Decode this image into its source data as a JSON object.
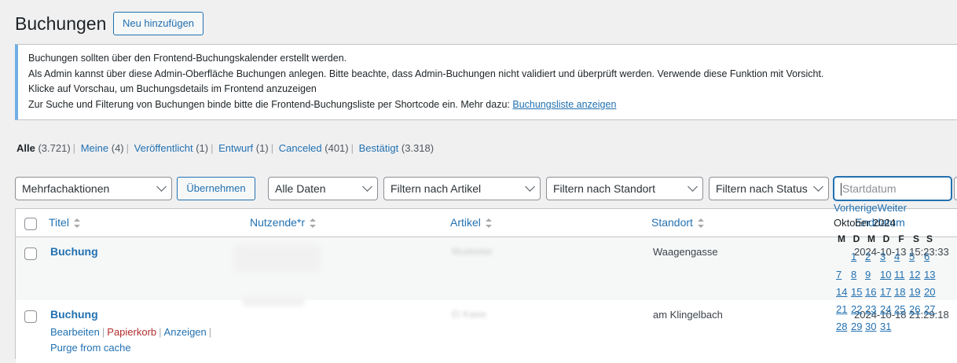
{
  "header": {
    "title": "Buchungen",
    "add_new": "Neu hinzufügen"
  },
  "notice": {
    "line1": "Buchungen sollten über den Frontend-Buchungskalender erstellt werden.",
    "line2": "Als Admin kannst über diese Admin-Oberfläche Buchungen anlegen. Bitte beachte, dass Admin-Buchungen nicht validiert und überprüft werden. Verwende diese Funktion mit Vorsicht.",
    "line3": "Klicke auf Vorschau, um Buchungsdetails im Frontend anzuzeigen",
    "line4_prefix": "Zur Suche und Filterung von Buchungen binde bitte die Frontend-Buchungsliste per Shortcode ein. Mehr dazu: ",
    "line4_link": "Buchungsliste anzeigen"
  },
  "views": [
    {
      "label": "Alle",
      "count": "(3.721)"
    },
    {
      "label": "Meine",
      "count": "(4)"
    },
    {
      "label": "Veröffentlicht",
      "count": "(1)"
    },
    {
      "label": "Entwurf",
      "count": "(1)"
    },
    {
      "label": "Canceled",
      "count": "(401)"
    },
    {
      "label": "Bestätigt",
      "count": "(3.318)"
    }
  ],
  "filters": {
    "bulk": "Mehrfachaktionen",
    "apply": "Übernehmen",
    "dates": "Alle Daten",
    "item": "Filtern nach Artikel",
    "location": "Filtern nach Standort",
    "status": "Filtern nach Status",
    "start_placeholder": "Startdatum"
  },
  "columns": {
    "title": "Titel",
    "user": "Nutzende*r",
    "item": "Artikel",
    "location": "Standort",
    "end": "Enddatum"
  },
  "rows": [
    {
      "title": "Buchung",
      "item": "Musketier",
      "location": "Waagengasse",
      "date": "2024-10-13 15:23:33"
    },
    {
      "title": "Buchung",
      "item": "El Kawe",
      "location": "am Klingelbach",
      "date": "2024-10-18 21:29:18"
    }
  ],
  "row_actions": {
    "edit": "Bearbeiten",
    "trash": "Papierkorb",
    "view": "Anzeigen",
    "purge": "Purge from cache"
  },
  "datepicker": {
    "prev": "Vorherige",
    "next": "Weiter",
    "month": "Oktober 2024",
    "weekdays": [
      "M",
      "D",
      "M",
      "D",
      "F",
      "S",
      "S"
    ],
    "weeks": [
      [
        "",
        "1",
        "2",
        "3",
        "4",
        "5",
        "6"
      ],
      [
        "7",
        "8",
        "9",
        "10",
        "11",
        "12",
        "13"
      ],
      [
        "14",
        "15",
        "16",
        "17",
        "18",
        "19",
        "20"
      ],
      [
        "21",
        "22",
        "23",
        "24",
        "25",
        "26",
        "27"
      ],
      [
        "28",
        "29",
        "30",
        "31",
        "",
        "",
        ""
      ]
    ]
  }
}
